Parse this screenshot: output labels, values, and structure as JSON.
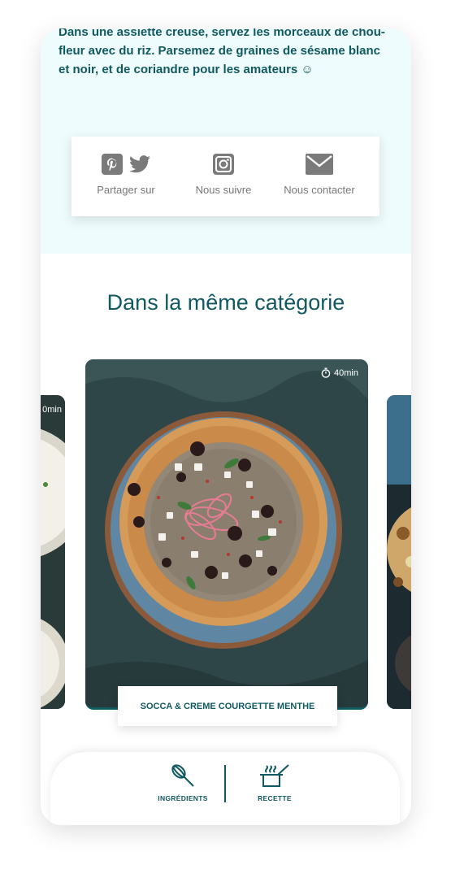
{
  "intro": {
    "text": "Dans une assiette creuse, servez les morceaux de chou-fleur avec du riz. Parsemez de graines de sésame blanc et noir, et de coriandre pour les amateurs ☺"
  },
  "share": {
    "share_label": "Partager sur",
    "follow_label": "Nous suivre",
    "contact_label": "Nous contacter"
  },
  "section": {
    "title": "Dans la même catégorie"
  },
  "carousel": {
    "left_time": "0min",
    "main": {
      "time": "40min",
      "title": "SOCCA & CREME COURGETTE MENTHE"
    }
  },
  "bottom_nav": {
    "ingredients_label": "INGRÉDIENTS",
    "recipe_label": "RECETTE"
  },
  "colors": {
    "accent": "#115960",
    "background_top": "#effcfd",
    "muted_icon": "#7a7a7a"
  }
}
